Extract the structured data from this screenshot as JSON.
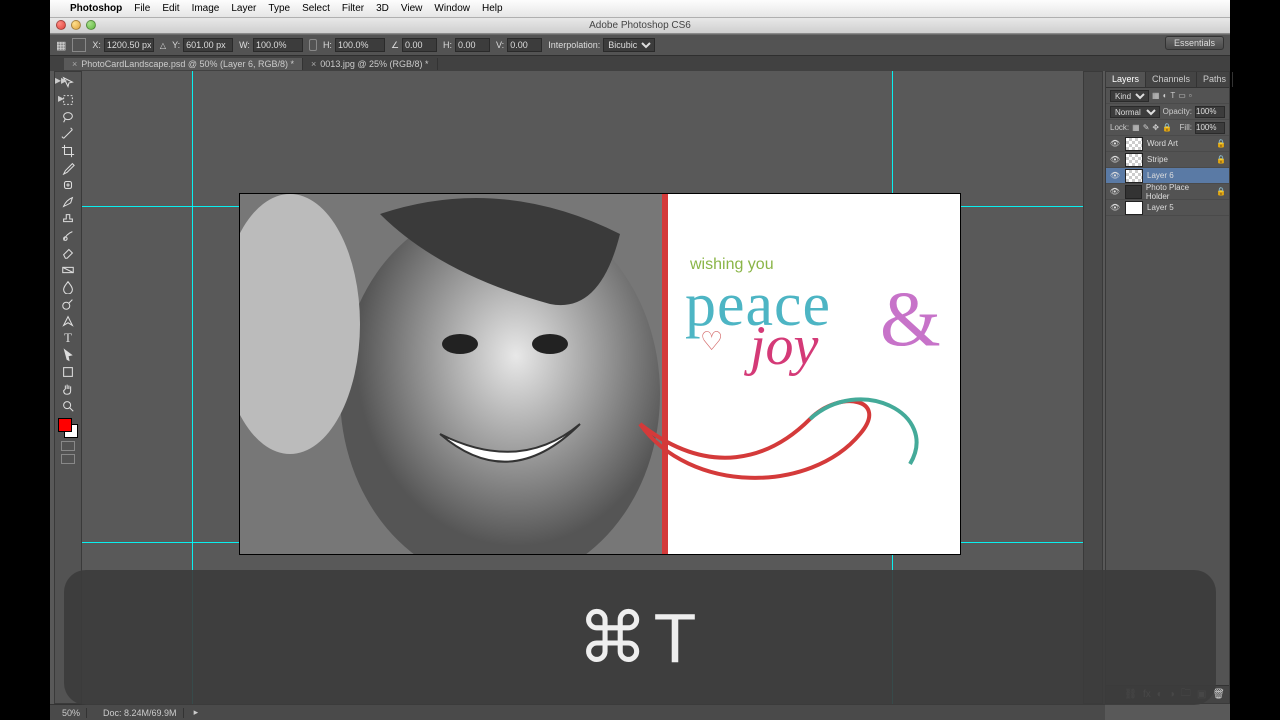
{
  "mac_menu": {
    "apple": "",
    "app_name": "Photoshop",
    "items": [
      "File",
      "Edit",
      "Image",
      "Layer",
      "Type",
      "Select",
      "Filter",
      "3D",
      "View",
      "Window",
      "Help"
    ]
  },
  "titlebar": {
    "title": "Adobe Photoshop CS6"
  },
  "workspace": {
    "label": "Essentials"
  },
  "options": {
    "x_label": "X:",
    "x_val": "1200.50 px",
    "y_label": "Y:",
    "y_val": "601.00 px",
    "w_label": "W:",
    "w_val": "100.0%",
    "h_label": "H:",
    "h_val": "100.0%",
    "angle_label": "∠",
    "angle_val": "0.00",
    "skewH_label": "H:",
    "skewH_val": "0.00",
    "skewV_label": "V:",
    "skewV_val": "0.00",
    "interp_label": "Interpolation:",
    "interp_val": "Bicubic"
  },
  "tabs": [
    {
      "label": "PhotoCardLandscape.psd @ 50% (Layer 6, RGB/8) *",
      "active": true
    },
    {
      "label": "0013.jpg @ 25% (RGB/8) *",
      "active": false
    }
  ],
  "canvas_art": {
    "wishing": "wishing you",
    "peace": "peace",
    "amp": "&",
    "joy": "joy",
    "heart": "♡"
  },
  "panels": {
    "tabs": [
      "Layers",
      "Channels",
      "Paths"
    ],
    "kind_label": "Kind",
    "blend_mode": "Normal",
    "opacity_label": "Opacity:",
    "opacity_val": "100%",
    "lock_label": "Lock:",
    "fill_label": "Fill:",
    "fill_val": "100%",
    "layers": [
      {
        "name": "Word Art",
        "locked": true,
        "checker": true
      },
      {
        "name": "Stripe",
        "locked": true,
        "checker": true
      },
      {
        "name": "Layer 6",
        "selected": true,
        "checker": true
      },
      {
        "name": "Photo Place Holder",
        "locked": true
      },
      {
        "name": "Layer 5",
        "white": true
      }
    ]
  },
  "status": {
    "zoom": "50%",
    "doc": "Doc: 8.24M/69.9M"
  },
  "shortcut": {
    "text": "⌘T"
  }
}
